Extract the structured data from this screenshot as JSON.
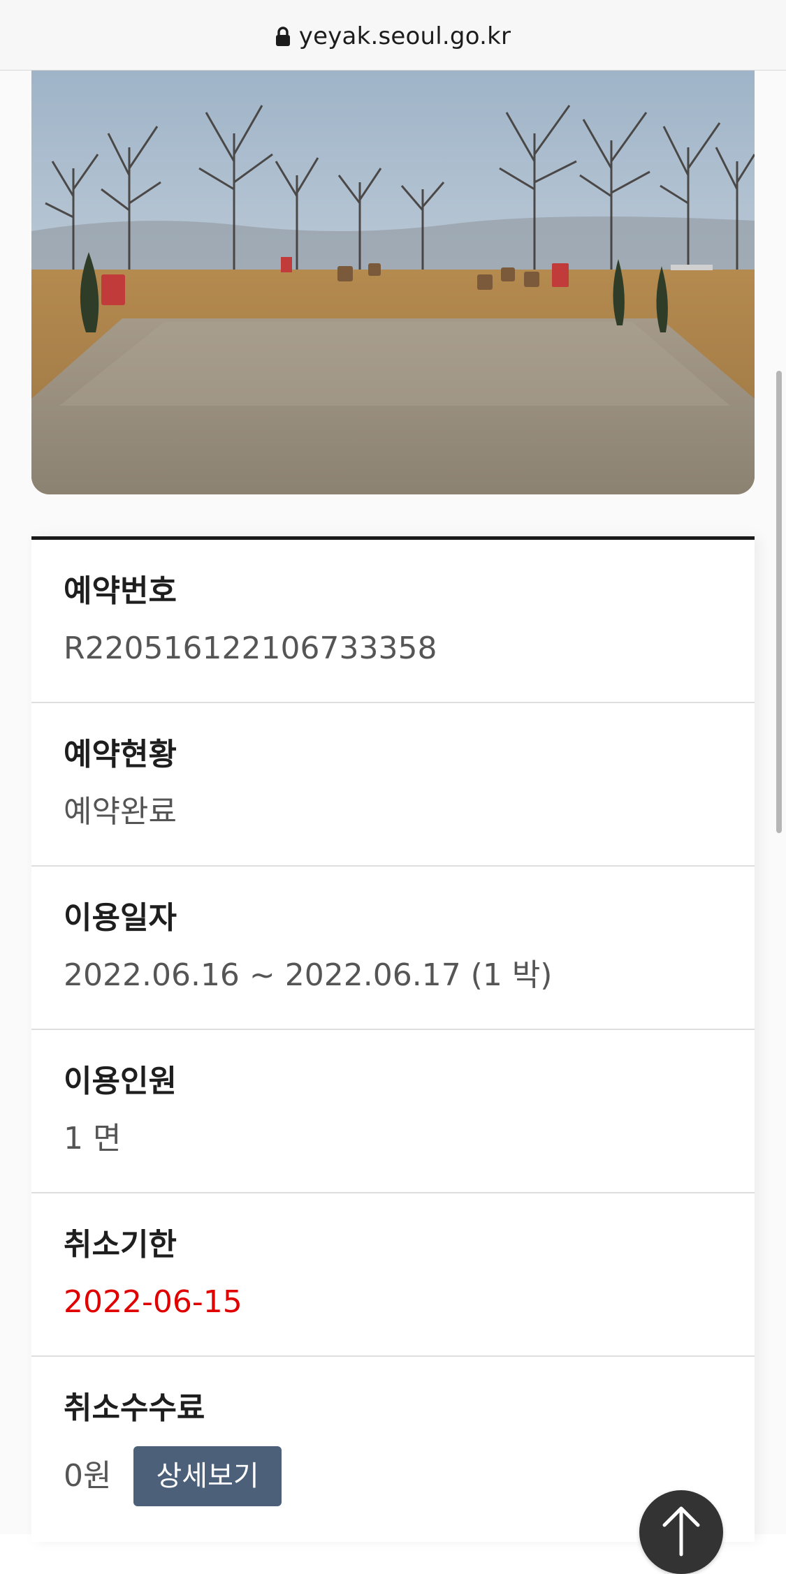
{
  "browser": {
    "url": "yeyak.seoul.go.kr",
    "lock_icon": "lock-icon"
  },
  "hero_image": {
    "description_icon": "campsite-photo"
  },
  "reservation": {
    "rows": [
      {
        "label": "예약번호",
        "value": "R220516122106733358"
      },
      {
        "label": "예약현황",
        "value": "예약완료"
      },
      {
        "label": "이용일자",
        "value": "2022.06.16 ~ 2022.06.17 (1 박)"
      },
      {
        "label": "이용인원",
        "value": "1 면"
      },
      {
        "label": "취소기한",
        "value": "2022-06-15",
        "color": "#e00000"
      },
      {
        "label": "취소수수료",
        "value": "0원",
        "button": "상세보기"
      }
    ]
  },
  "scroll_top": {
    "icon": "arrow-up-icon"
  },
  "colors": {
    "accent_button": "#4d6079",
    "deadline_red": "#e00000",
    "header_rule": "#1a1a1a"
  }
}
